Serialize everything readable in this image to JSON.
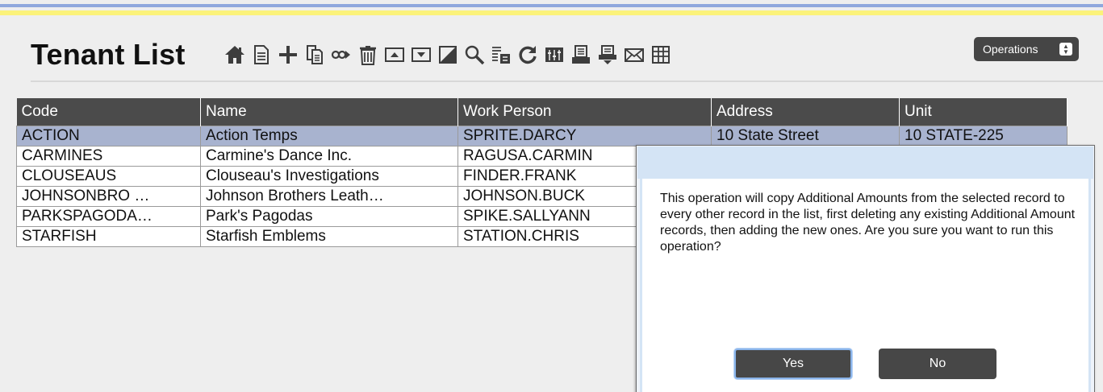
{
  "header": {
    "title": "Tenant List",
    "operations_label": "Operations",
    "accent_blue": "#8fa7dd",
    "accent_yellow": "#fbf27a"
  },
  "toolbar": {
    "icons": [
      "home-icon",
      "document-icon",
      "plus-icon",
      "copy-icon",
      "link-icon",
      "trash-icon",
      "move-up-icon",
      "move-down-icon",
      "edit-icon",
      "search-icon",
      "filter-icon",
      "refresh-icon",
      "columns-icon",
      "print-icon",
      "print-preview-icon",
      "mail-icon",
      "grid-icon"
    ]
  },
  "table": {
    "columns": [
      "Code",
      "Name",
      "Work Person",
      "Address",
      "Unit"
    ],
    "rows": [
      {
        "code": "ACTION",
        "name": "Action Temps",
        "person": "SPRITE.DARCY",
        "address": "10 State Street",
        "unit": "10 STATE-225",
        "selected": true
      },
      {
        "code": "CARMINES",
        "name": "Carmine's Dance Inc.",
        "person": "RAGUSA.CARMIN",
        "address": "",
        "unit": "",
        "selected": false
      },
      {
        "code": "CLOUSEAUS",
        "name": "Clouseau's Investigations",
        "person": "FINDER.FRANK",
        "address": "",
        "unit": "",
        "selected": false
      },
      {
        "code": "JOHNSONBRO …",
        "name": "Johnson Brothers Leath…",
        "person": "JOHNSON.BUCK",
        "address": "",
        "unit": "",
        "selected": false
      },
      {
        "code": "PARKSPAGODA…",
        "name": "Park's Pagodas",
        "person": "SPIKE.SALLYANN",
        "address": "",
        "unit": "",
        "selected": false
      },
      {
        "code": "STARFISH",
        "name": "Starfish Emblems",
        "person": "STATION.CHRIS",
        "address": "",
        "unit": "",
        "selected": false
      }
    ],
    "header_color": "#4b4b4b",
    "selected_color": "#a8b3cf"
  },
  "dialog": {
    "message": "This operation will copy Additional Amounts from the selected record to every other record in the list, first deleting any existing Additional Amount records, then adding the new ones.  Are you sure you want to run this operation?",
    "yes_label": "Yes",
    "no_label": "No"
  }
}
